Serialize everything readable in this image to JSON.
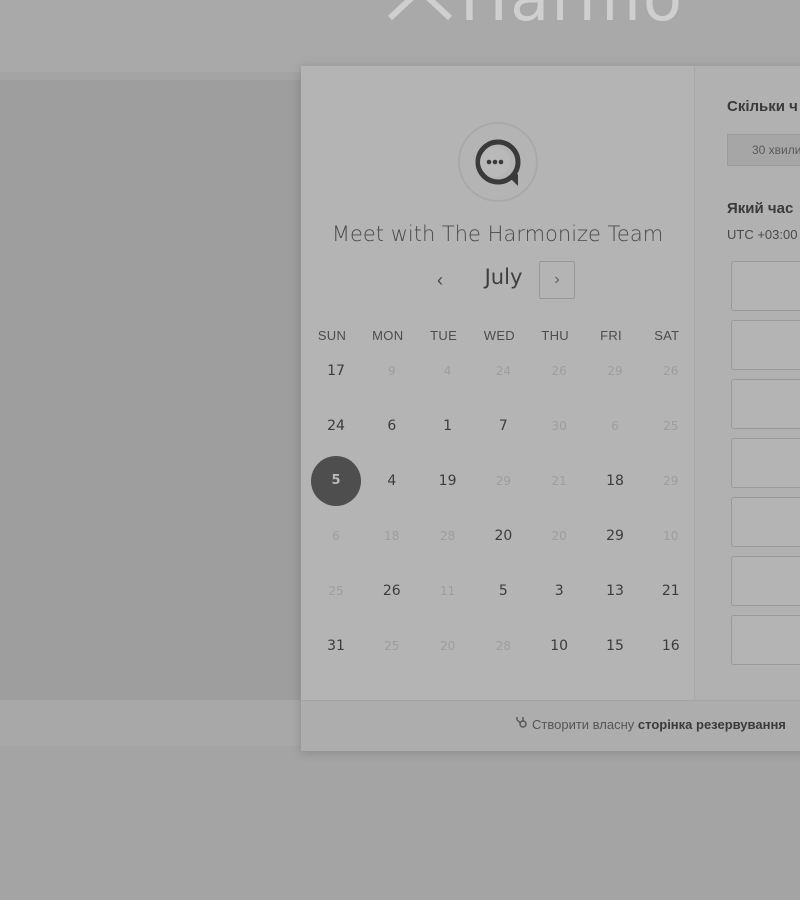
{
  "background": {
    "logo_text": "Harmo"
  },
  "booking": {
    "title": "Meet with The Harmonize Team",
    "month": "July",
    "prev_icon": "‹",
    "next_icon": "›",
    "weekdays": [
      "SUN",
      "MON",
      "TUE",
      "WED",
      "THU",
      "FRI",
      "SAT"
    ],
    "weeks": [
      [
        {
          "d": "17",
          "s": "available"
        },
        {
          "d": "9",
          "s": "disabled"
        },
        {
          "d": "4",
          "s": "disabled"
        },
        {
          "d": "24",
          "s": "disabled"
        },
        {
          "d": "26",
          "s": "disabled"
        },
        {
          "d": "29",
          "s": "disabled"
        },
        {
          "d": "26",
          "s": "disabled"
        }
      ],
      [
        {
          "d": "24",
          "s": "available"
        },
        {
          "d": "6",
          "s": "available"
        },
        {
          "d": "1",
          "s": "available"
        },
        {
          "d": "7",
          "s": "available"
        },
        {
          "d": "30",
          "s": "disabled"
        },
        {
          "d": "6",
          "s": "disabled"
        },
        {
          "d": "25",
          "s": "disabled"
        }
      ],
      [
        {
          "d": "5",
          "s": "selected"
        },
        {
          "d": "4",
          "s": "available"
        },
        {
          "d": "19",
          "s": "available"
        },
        {
          "d": "29",
          "s": "disabled"
        },
        {
          "d": "21",
          "s": "disabled"
        },
        {
          "d": "18",
          "s": "available"
        },
        {
          "d": "29",
          "s": "disabled"
        }
      ],
      [
        {
          "d": "6",
          "s": "disabled"
        },
        {
          "d": "18",
          "s": "disabled"
        },
        {
          "d": "28",
          "s": "disabled"
        },
        {
          "d": "20",
          "s": "available"
        },
        {
          "d": "20",
          "s": "disabled"
        },
        {
          "d": "29",
          "s": "available"
        },
        {
          "d": "10",
          "s": "disabled"
        }
      ],
      [
        {
          "d": "25",
          "s": "disabled"
        },
        {
          "d": "26",
          "s": "available"
        },
        {
          "d": "11",
          "s": "disabled"
        },
        {
          "d": "5",
          "s": "available"
        },
        {
          "d": "3",
          "s": "available"
        },
        {
          "d": "13",
          "s": "available"
        },
        {
          "d": "21",
          "s": "available"
        }
      ],
      [
        {
          "d": "31",
          "s": "available"
        },
        {
          "d": "25",
          "s": "disabled"
        },
        {
          "d": "20",
          "s": "disabled"
        },
        {
          "d": "28",
          "s": "disabled"
        },
        {
          "d": "10",
          "s": "available"
        },
        {
          "d": "15",
          "s": "available"
        },
        {
          "d": "16",
          "s": "available"
        }
      ]
    ],
    "duration_question": "Скільки ч",
    "duration_option": "30 хвили",
    "time_question": "Який час",
    "timezone": "UTC +03:00",
    "time_slot_count": 7
  },
  "footer": {
    "icon": "hubspot-sprocket-icon",
    "text_prefix": "Створити власну",
    "text_bold": "сторінка резервування"
  },
  "colors": {
    "selected_day": "#4e4e4e",
    "available_day": "#3c3c3c",
    "disabled_day": "#9e9e9e"
  }
}
